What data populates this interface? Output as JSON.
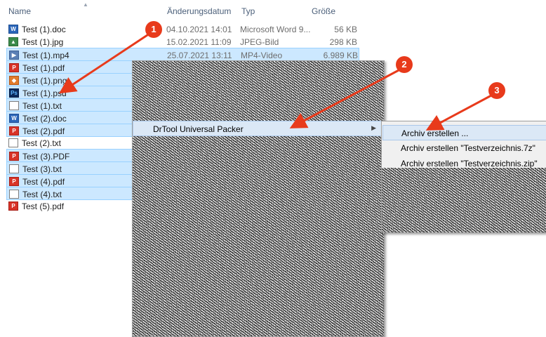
{
  "header": {
    "col_name": "Name",
    "col_date": "Änderungsdatum",
    "col_type": "Typ",
    "col_size": "Größe"
  },
  "files": [
    {
      "name": "Test (1).doc",
      "date": "04.10.2021 14:01",
      "type": "Microsoft Word 9...",
      "size": "56 KB",
      "icon": "doc-file-icon",
      "selected": false
    },
    {
      "name": "Test (1).jpg",
      "date": "15.02.2021 11:09",
      "type": "JPEG-Bild",
      "size": "298 KB",
      "icon": "jpg-file-icon",
      "selected": false
    },
    {
      "name": "Test (1).mp4",
      "date": "25.07.2021 13:11",
      "type": "MP4-Video",
      "size": "6.989 KB",
      "icon": "mp4-file-icon",
      "selected": true
    },
    {
      "name": "Test (1).pdf",
      "date": "",
      "type": "",
      "size": "",
      "icon": "pdf-file-icon",
      "selected": true
    },
    {
      "name": "Test (1).png",
      "date": "",
      "type": "",
      "size": "",
      "icon": "png-file-icon",
      "selected": true
    },
    {
      "name": "Test (1).psd",
      "date": "",
      "type": "",
      "size": "",
      "icon": "psd-file-icon",
      "selected": true
    },
    {
      "name": "Test (1).txt",
      "date": "",
      "type": "",
      "size": "",
      "icon": "txt-file-icon",
      "selected": true
    },
    {
      "name": "Test (2).doc",
      "date": "",
      "type": "",
      "size": "",
      "icon": "doc-file-icon",
      "selected": true
    },
    {
      "name": "Test (2).pdf",
      "date": "",
      "type": "",
      "size": "",
      "icon": "pdf-file-icon",
      "selected": true
    },
    {
      "name": "Test (2).txt",
      "date": "",
      "type": "",
      "size": "",
      "icon": "txt-file-icon",
      "selected": false
    },
    {
      "name": "Test (3).PDF",
      "date": "",
      "type": "",
      "size": "",
      "icon": "pdf-file-icon",
      "selected": true
    },
    {
      "name": "Test (3).txt",
      "date": "",
      "type": "",
      "size": "",
      "icon": "txt-file-icon",
      "selected": true
    },
    {
      "name": "Test (4).pdf",
      "date": "",
      "type": "",
      "size": "",
      "icon": "pdf-file-icon",
      "selected": true
    },
    {
      "name": "Test (4).txt",
      "date": "",
      "type": "",
      "size": "",
      "icon": "txt-file-icon",
      "selected": true
    },
    {
      "name": "Test (5).pdf",
      "date": "",
      "type": "",
      "size": "",
      "icon": "pdf-file-icon",
      "selected": false
    }
  ],
  "context_menu": {
    "highlighted_item": "DrTool Universal Packer"
  },
  "submenu": {
    "items": [
      "Archiv erstellen ...",
      "Archiv erstellen \"Testverzeichnis.7z\"",
      "Archiv erstellen \"Testverzeichnis.zip\""
    ]
  },
  "badges": [
    "1",
    "2",
    "3"
  ],
  "colors": {
    "selection_bg": "#cce8ff",
    "selection_border": "#99d1ff",
    "menu_bg": "#f0f0f0",
    "highlight_bg": "#dbe8f6",
    "annotation_red": "#e83a1b"
  }
}
